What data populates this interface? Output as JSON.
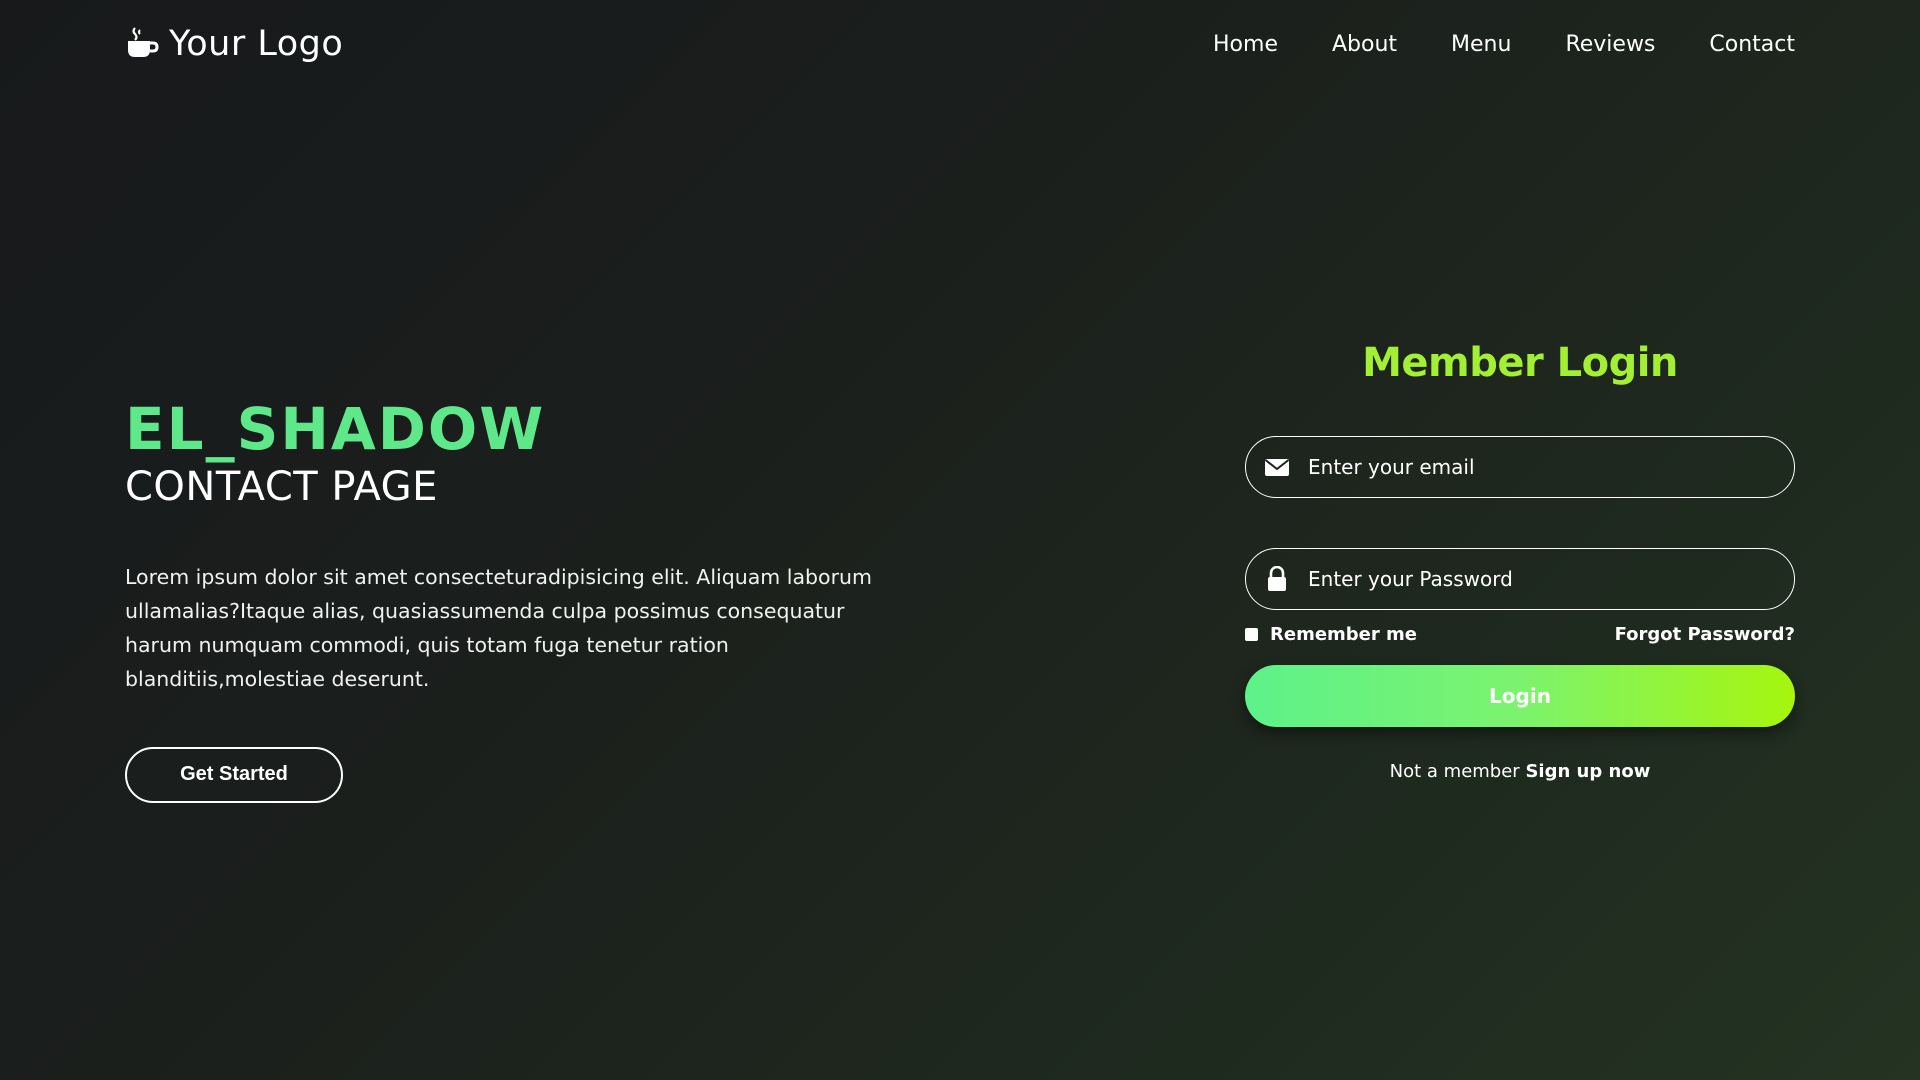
{
  "header": {
    "logo_text": "Your Logo",
    "logo_icon": "coffee-cup-icon",
    "nav": [
      {
        "label": "Home"
      },
      {
        "label": "About"
      },
      {
        "label": "Menu"
      },
      {
        "label": "Reviews"
      },
      {
        "label": "Contact"
      }
    ]
  },
  "hero": {
    "title": "EL_SHADOW",
    "subtitle": "CONTACT PAGE",
    "paragraph": "Lorem ipsum dolor sit amet consecteturadipisicing elit. Aliquam laborum ullamalias?Itaque alias, quasiassumenda culpa possimus consequatur harum numquam commodi, quis totam fuga tenetur ration blanditiis,molestiae deserunt.",
    "cta_label": "Get Started"
  },
  "login": {
    "title": "Member Login",
    "email": {
      "placeholder": "Enter your email",
      "value": "",
      "icon": "envelope-icon"
    },
    "password": {
      "placeholder": "Enter your Password",
      "value": "",
      "icon": "lock-icon"
    },
    "remember_label": "Remember me",
    "remember_checked": false,
    "forgot_label": "Forgot Password?",
    "submit_label": "Login",
    "signup_prompt": "Not a member",
    "signup_link": "Sign up now"
  },
  "colors": {
    "accent_green": "#5fe88a",
    "title_lime": "#a3ef34",
    "button_gradient_start": "#5df28a",
    "button_gradient_end": "#a6f50d"
  }
}
